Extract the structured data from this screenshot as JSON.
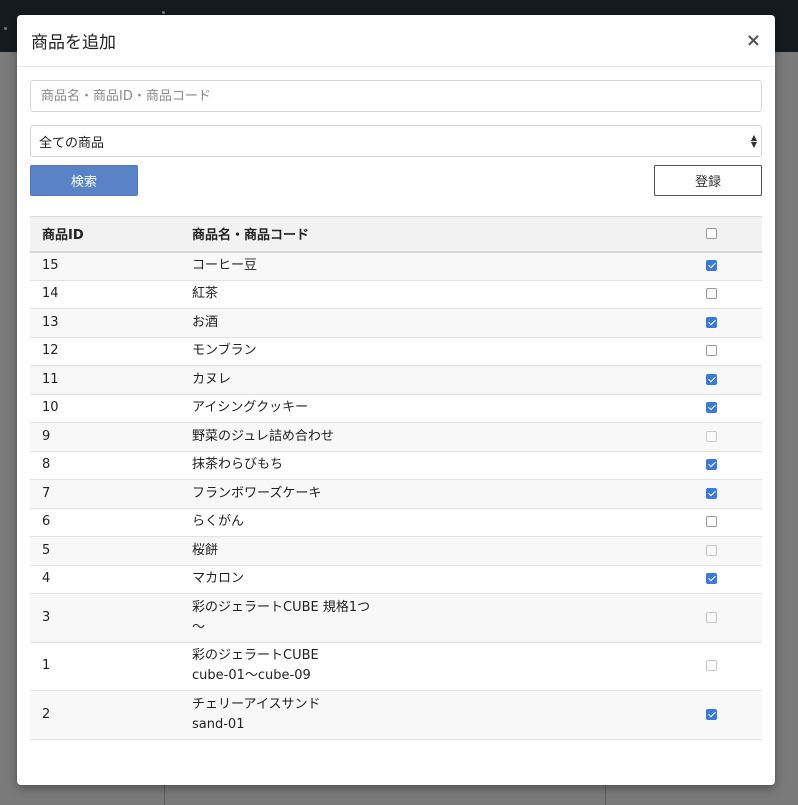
{
  "modal": {
    "title": "商品を追加",
    "close_label": "×"
  },
  "search": {
    "placeholder": "商品名・商品ID・商品コード",
    "value": ""
  },
  "filter": {
    "selected": "全ての商品"
  },
  "buttons": {
    "search_label": "検索",
    "register_label": "登録"
  },
  "table": {
    "headers": {
      "id": "商品ID",
      "name": "商品名・商品コード"
    },
    "header_checked": false,
    "rows": [
      {
        "id": "15",
        "name": "コーヒー豆",
        "code": "",
        "checked": true,
        "disabled": false
      },
      {
        "id": "14",
        "name": "紅茶",
        "code": "",
        "checked": false,
        "disabled": false
      },
      {
        "id": "13",
        "name": "お酒",
        "code": "",
        "checked": true,
        "disabled": false
      },
      {
        "id": "12",
        "name": "モンブラン",
        "code": "",
        "checked": false,
        "disabled": false
      },
      {
        "id": "11",
        "name": "カヌレ",
        "code": "",
        "checked": true,
        "disabled": false
      },
      {
        "id": "10",
        "name": "アイシングクッキー",
        "code": "",
        "checked": true,
        "disabled": false
      },
      {
        "id": "9",
        "name": "野菜のジュレ詰め合わせ",
        "code": "",
        "checked": false,
        "disabled": true
      },
      {
        "id": "8",
        "name": "抹茶わらびもち",
        "code": "",
        "checked": true,
        "disabled": false
      },
      {
        "id": "7",
        "name": "フランボワーズケーキ",
        "code": "",
        "checked": true,
        "disabled": false
      },
      {
        "id": "6",
        "name": "らくがん",
        "code": "",
        "checked": false,
        "disabled": false
      },
      {
        "id": "5",
        "name": "桜餅",
        "code": "",
        "checked": false,
        "disabled": true
      },
      {
        "id": "4",
        "name": "マカロン",
        "code": "",
        "checked": true,
        "disabled": false
      },
      {
        "id": "3",
        "name": "彩のジェラートCUBE 規格1つ",
        "code": "〜",
        "checked": false,
        "disabled": true
      },
      {
        "id": "1",
        "name": "彩のジェラートCUBE",
        "code": "cube-01〜cube-09",
        "checked": false,
        "disabled": true
      },
      {
        "id": "2",
        "name": "チェリーアイスサンド",
        "code": "sand-01",
        "checked": true,
        "disabled": false
      }
    ]
  },
  "colors": {
    "primary_button": "#5a83c7",
    "checkbox_checked": "#3b79d9"
  }
}
